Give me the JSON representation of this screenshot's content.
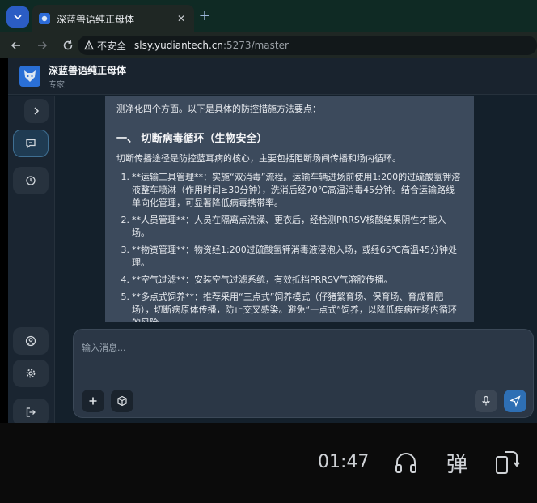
{
  "browser": {
    "tab_title": "深蓝兽语纯正母体",
    "tab_close": "✕",
    "new_tab": "+",
    "insecure_label": "不安全",
    "url_host": "slsy.yudiantech.cn",
    "url_rest": ":5273/master"
  },
  "app": {
    "title": "深蓝兽语纯正母体",
    "subtitle": "专家"
  },
  "message": {
    "intro": "测净化四个方面。以下是具体的防控措施方法要点：",
    "heading": "一、 切断病毒循环（生物安全）",
    "paragraph": "切断传播途径是防控蓝耳病的核心，主要包括阻断场间传播和场内循环。",
    "items": [
      {
        "num": "1.",
        "text": "**运输工具管理**：实施“双消毒”流程。运输车辆进场前使用1:200的过硫酸氢钾溶液整车喷淋（作用时间≥30分钟），洗消后经70℃高温消毒45分钟。结合运输路线单向化管理，可显著降低病毒携带率。"
      },
      {
        "num": "2.",
        "text": "**人员管理**：人员在隔离点洗澡、更衣后，经检测PRRSV核酸结果阴性才能入场。"
      },
      {
        "num": "3.",
        "text": "**物资管理**：物资经1:200过硫酸氢钾消毒液浸泡入场，或经65℃高温45分钟处理。"
      },
      {
        "num": "4.",
        "text": "**空气过滤**：安装空气过滤系统，有效抵挡PRRSV气溶胶传播。"
      },
      {
        "num": "5.",
        "text": "**多点式饲养**：推荐采用“三点式”饲养模式（仔猪繁育场、保育场、育成育肥场），切断病原体传播，防止交叉感染。避免“一点式”饲养，以降低疾病在场内循环的风险。"
      }
    ]
  },
  "composer": {
    "placeholder": "输入消息..."
  },
  "overlay": {
    "time": "01:47",
    "danmu": "弹"
  },
  "colors": {
    "accent": "#2e6fb4",
    "card": "#3c4a5c",
    "background": "#14202b"
  },
  "icons": {
    "sidebar": [
      "chevron-right-icon",
      "chat-icon",
      "history-icon",
      "user-icon",
      "gear-icon",
      "logout-icon"
    ],
    "composer": [
      "plus-icon",
      "cube-icon",
      "microphone-icon",
      "send-icon"
    ],
    "overlay": [
      "headphones-icon",
      "danmu-icon",
      "rotate-icon"
    ]
  }
}
